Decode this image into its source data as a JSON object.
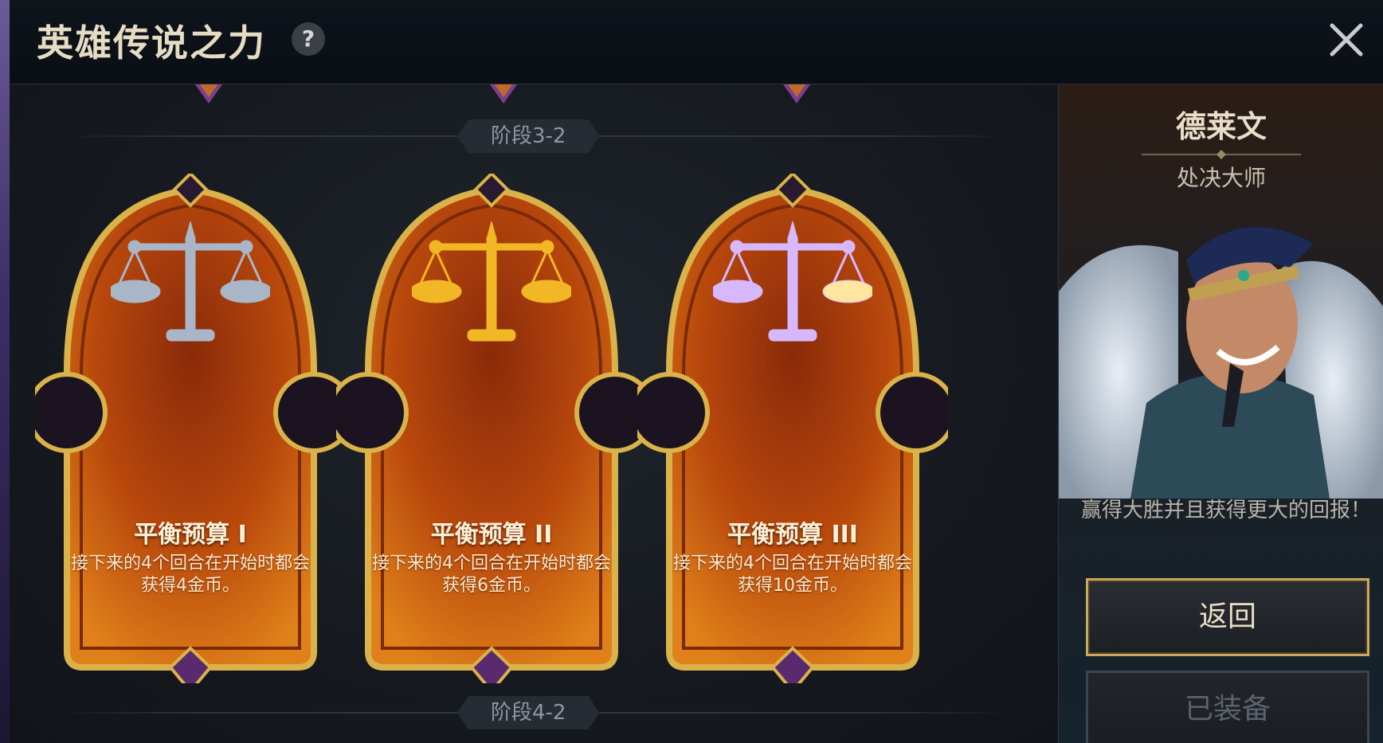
{
  "header": {
    "title": "英雄传说之力",
    "help_icon": "?"
  },
  "stages": {
    "upper": "阶段3-2",
    "lower": "阶段4-2"
  },
  "cards": [
    {
      "name": "平衡预算 I",
      "description": "接下来的4个回合在开始时都会获得4金币。",
      "tier_color": "#a9b6c8",
      "icon": "balance-scale-icon"
    },
    {
      "name": "平衡预算 II",
      "description": "接下来的4个回合在开始时都会获得6金币。",
      "tier_color": "#f2b724",
      "icon": "balance-scale-icon"
    },
    {
      "name": "平衡预算 III",
      "description": "接下来的4个回合在开始时都会获得10金币。",
      "tier_color": "#d7b8ff",
      "icon": "balance-scale-icon"
    }
  ],
  "champion": {
    "name": "德莱文",
    "title": "处决大师",
    "quote": "赢得大胜并且获得更大的回报！"
  },
  "buttons": {
    "back": "返回",
    "equipped": "已装备"
  },
  "colors": {
    "card_orange": "#c2530e",
    "gold_frame": "#d9b24a",
    "accent_purple": "#6b5a9a"
  }
}
